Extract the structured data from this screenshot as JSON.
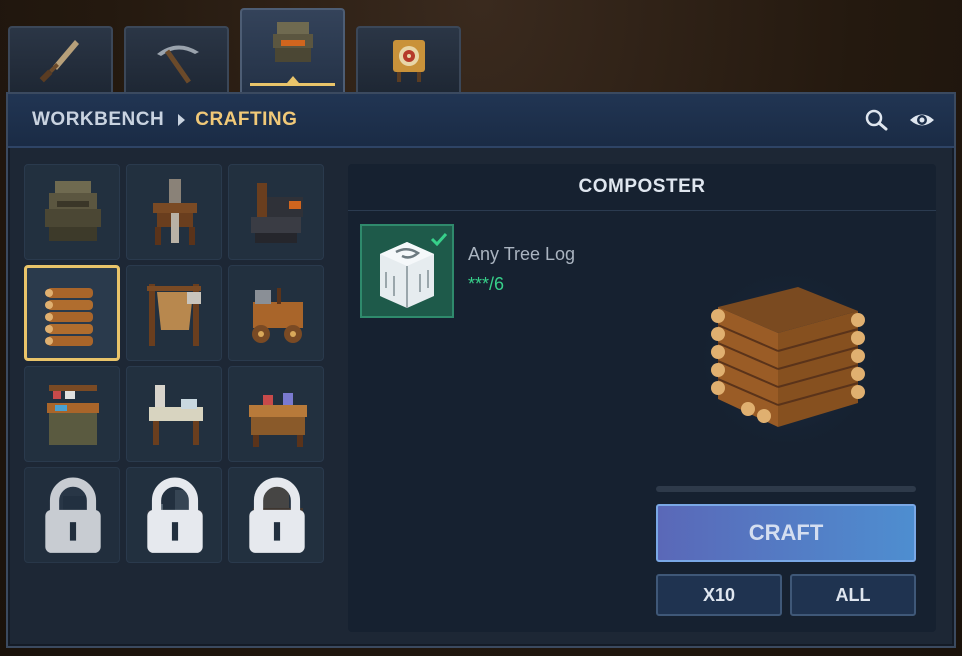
{
  "tabs": [
    {
      "name": "weapons",
      "icon": "dagger-icon",
      "active": false
    },
    {
      "name": "tools",
      "icon": "pickaxe-icon",
      "active": false
    },
    {
      "name": "workbench",
      "icon": "workbench-icon",
      "active": true
    },
    {
      "name": "targets",
      "icon": "target-dummy-icon",
      "active": false
    }
  ],
  "header": {
    "breadcrumb_root": "WORKBENCH",
    "breadcrumb_current": "CRAFTING",
    "search_icon": "search-icon",
    "visibility_icon": "eye-icon"
  },
  "recipes": [
    {
      "id": "workbench",
      "locked": false,
      "selected": false
    },
    {
      "id": "spinning-station",
      "locked": false,
      "selected": false
    },
    {
      "id": "anvil-forge",
      "locked": false,
      "selected": false
    },
    {
      "id": "composter",
      "locked": false,
      "selected": true
    },
    {
      "id": "tanning-rack",
      "locked": false,
      "selected": false
    },
    {
      "id": "cooking-cart",
      "locked": false,
      "selected": false
    },
    {
      "id": "alchemy-table",
      "locked": false,
      "selected": false
    },
    {
      "id": "tailoring-table",
      "locked": false,
      "selected": false
    },
    {
      "id": "carpentry-bench",
      "locked": false,
      "selected": false
    },
    {
      "id": "locked-station-1",
      "locked": true,
      "selected": false
    },
    {
      "id": "locked-station-2",
      "locked": true,
      "selected": false
    },
    {
      "id": "locked-station-3",
      "locked": true,
      "selected": false
    }
  ],
  "detail": {
    "title": "COMPOSTER",
    "ingredient": {
      "name": "Any Tree Log",
      "count": "***/6",
      "icon": "tree-log-icon",
      "status_icon": "checkmark-icon"
    },
    "craft_label": "CRAFT",
    "x10_label": "X10",
    "all_label": "ALL"
  },
  "colors": {
    "accent_gold": "#e9c46a",
    "ingredient_ok": "#37d08a",
    "craft_button": "#5a7cc4"
  }
}
